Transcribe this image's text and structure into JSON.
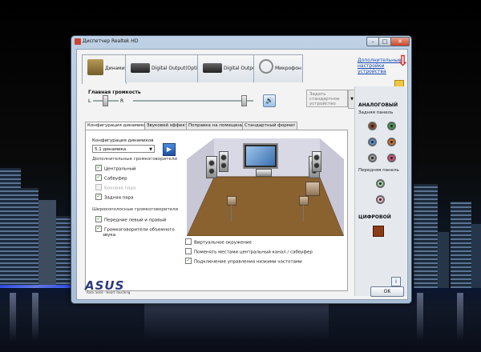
{
  "window": {
    "title": "Диспетчер Realtek HD",
    "btn_min": "–",
    "btn_max": "□",
    "btn_close": "✕"
  },
  "top_tabs": [
    {
      "label": "Динамики",
      "icon": "speaker-icon"
    },
    {
      "label": "Digital Output(Optical)",
      "icon": "optical-output-icon"
    },
    {
      "label": "Digital Output",
      "icon": "digital-output-icon"
    },
    {
      "label": "Микрофон",
      "icon": "microphone-icon"
    }
  ],
  "advanced_link": "Дополнительные настройки устройства",
  "volume": {
    "label": "Главная громкость",
    "left": "L",
    "right": "R",
    "level": 0.92,
    "balance": 0.5,
    "mute_icon": "🔊",
    "default_btn": "Задать стандартное устройство",
    "default_drop": "▼"
  },
  "sub_tabs": [
    "Конфигурация динамиков",
    "Звуковой эффект",
    "Поправка на помещение",
    "Стандартный формат"
  ],
  "config": {
    "label": "Конфигурация динамиков",
    "selected": "5.1 динамика",
    "drop": "▼",
    "play": "▶"
  },
  "extra_speakers": {
    "title": "Дополнительные громкоговорители",
    "items": [
      {
        "label": "Центральный",
        "checked": "✓",
        "disabled": false
      },
      {
        "label": "Сабвуфер",
        "checked": "✓",
        "disabled": false
      },
      {
        "label": "Боковая пара",
        "checked": "",
        "disabled": true
      },
      {
        "label": "Задняя пара",
        "checked": "✓",
        "disabled": false
      }
    ]
  },
  "fullrange": {
    "title": "Широкополосные громкоговорители",
    "items": [
      {
        "label": "Передние левый и правый",
        "checked": "✓"
      },
      {
        "label": "Громкоговорители объемного",
        "label2": "звука",
        "checked": "✓"
      }
    ]
  },
  "options": [
    {
      "label": "Виртуальное окружение",
      "checked": ""
    },
    {
      "label": "Поменять местами центральный канал / сабвуфер",
      "checked": ""
    },
    {
      "label": "Подключение управления низкими частотами",
      "checked": "✓"
    }
  ],
  "right_panel": {
    "analog_title": "АНАЛОГОВЫЙ",
    "rear_label": "Задняя панель",
    "front_label": "Передняя панель",
    "digital_title": "ЦИФРОВОЙ",
    "colors": {
      "brown": "#8a3d1c",
      "green": "#3a9b4a",
      "blue": "#5b8fd6",
      "orange": "#d76d1d",
      "grey": "#9a9a9a",
      "pink": "#d64a7a",
      "front_green": "#9fd3a5",
      "front_pink": "#ecb2c6"
    }
  },
  "brand": {
    "logo": "ASUS",
    "slogan": "Rock Solid · Heart Touching"
  },
  "info_icon": "i",
  "ok_label": "OK",
  "arrow_icon": "⇩"
}
